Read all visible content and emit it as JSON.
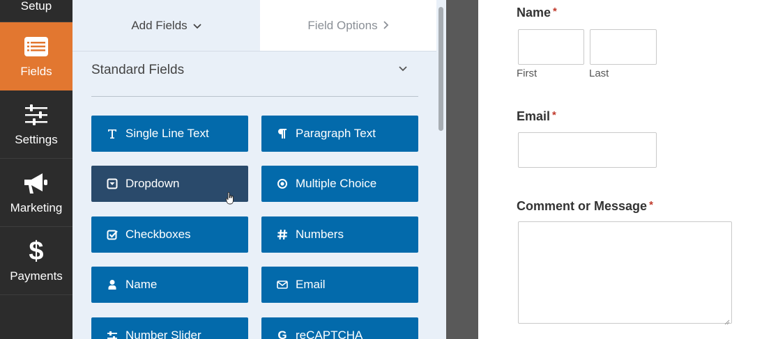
{
  "nav": {
    "items": [
      {
        "label": "Setup",
        "icon": "setup-icon"
      },
      {
        "label": "Fields",
        "icon": "fields-icon",
        "active": true
      },
      {
        "label": "Settings",
        "icon": "sliders-icon"
      },
      {
        "label": "Marketing",
        "icon": "megaphone-icon"
      },
      {
        "label": "Payments",
        "icon": "dollar-icon"
      }
    ]
  },
  "panel": {
    "tabs": [
      {
        "label": "Add Fields",
        "icon": "chevron-down-icon"
      },
      {
        "label": "Field Options",
        "icon": "chevron-right-icon"
      }
    ],
    "section": {
      "title": "Standard Fields",
      "icon": "chevron-down-icon"
    },
    "fields": [
      {
        "label": "Single Line Text",
        "icon": "text-icon"
      },
      {
        "label": "Paragraph Text",
        "icon": "paragraph-icon"
      },
      {
        "label": "Dropdown",
        "icon": "dropdown-icon"
      },
      {
        "label": "Multiple Choice",
        "icon": "radio-icon"
      },
      {
        "label": "Checkboxes",
        "icon": "checkbox-icon"
      },
      {
        "label": "Numbers",
        "icon": "hash-icon"
      },
      {
        "label": "Name",
        "icon": "user-icon"
      },
      {
        "label": "Email",
        "icon": "envelope-icon"
      },
      {
        "label": "Number Slider",
        "icon": "slider-icon"
      },
      {
        "label": "reCAPTCHA",
        "icon": "google-icon"
      }
    ]
  },
  "form": {
    "name": {
      "label": "Name",
      "required_mark": "*",
      "first_label": "First",
      "last_label": "Last"
    },
    "email": {
      "label": "Email",
      "required_mark": "*"
    },
    "comment": {
      "label": "Comment or Message",
      "required_mark": "*"
    }
  },
  "colors": {
    "nav_bg": "#2c2c2c",
    "nav_active": "#e27730",
    "panel_bg": "#e9f0f8",
    "field_button": "#036aab",
    "field_button_hover": "#2a4a6b",
    "required": "#c0392b"
  }
}
